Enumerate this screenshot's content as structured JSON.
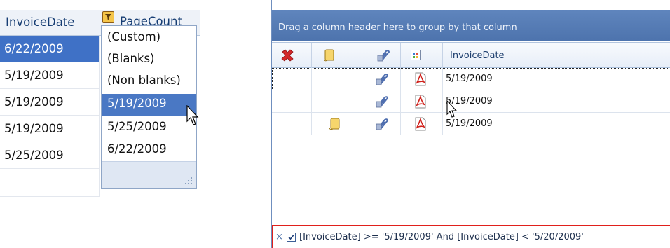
{
  "left_grid": {
    "columns": [
      "InvoiceDate",
      "PageCount"
    ],
    "rows": [
      {
        "date": "6/22/2009",
        "selected": true
      },
      {
        "date": "5/19/2009",
        "selected": false
      },
      {
        "date": "5/19/2009",
        "selected": false
      },
      {
        "date": "5/19/2009",
        "selected": false
      },
      {
        "date": "5/25/2009",
        "selected": false
      }
    ],
    "filter_dropdown": {
      "items": [
        "(Custom)",
        "(Blanks)",
        "(Non blanks)",
        "5/19/2009",
        "5/25/2009",
        "6/22/2009"
      ],
      "highlighted": "5/19/2009"
    }
  },
  "right_grid": {
    "group_panel_text": "Drag a column header here to group by that column",
    "columns": [
      {
        "icon": "delete-x-icon"
      },
      {
        "icon": "note-icon"
      },
      {
        "icon": "attachment-paperclip-icon"
      },
      {
        "icon": "document-type-icon"
      },
      {
        "label": "InvoiceDate"
      }
    ],
    "rows": [
      {
        "note": false,
        "attachment": true,
        "pdf": true,
        "date": "5/19/2009",
        "focused": true
      },
      {
        "note": false,
        "attachment": true,
        "pdf": true,
        "date": "5/19/2009",
        "focused": false
      },
      {
        "note": true,
        "attachment": true,
        "pdf": true,
        "date": "5/19/2009",
        "focused": false
      }
    ],
    "filter_bar": {
      "close_glyph": "×",
      "checked": true,
      "expression": "[InvoiceDate] >= '5/19/2009' And [InvoiceDate] < '5/20/2009'"
    }
  },
  "colors": {
    "selection": "#3f71c6",
    "header_text": "#163d73",
    "group_bar": "#5679b4",
    "filter_border": "#e0201c"
  }
}
